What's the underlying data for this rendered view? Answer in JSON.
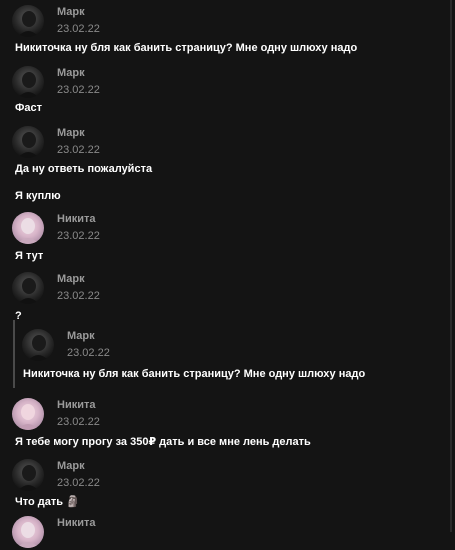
{
  "messages": [
    {
      "author": "Марк",
      "date": "23.02.22",
      "text": "Никиточка ну бля как банить страницу? Мне одну шлюху надо"
    },
    {
      "author": "Марк",
      "date": "23.02.22",
      "text": "Фаст"
    },
    {
      "author": "Марк",
      "date": "23.02.22",
      "text": "Да ну ответь пожалуйста",
      "text2": "Я куплю"
    },
    {
      "author": "Никита",
      "date": "23.02.22",
      "text": "Я тут"
    },
    {
      "author": "Марк",
      "date": "23.02.22",
      "text": "?"
    },
    {
      "author": "Никита",
      "date": "23.02.22",
      "text": "Я тебе могу прогу за 350₽ дать и все мне лень делать"
    },
    {
      "author": "Марк",
      "date": "23.02.22",
      "text": "Что дать 🗿"
    },
    {
      "author": "Никита"
    }
  ],
  "quote": {
    "author": "Марк",
    "date": "23.02.22",
    "text": "Никиточка ну бля как банить страницу? Мне одну шлюху надо"
  },
  "colors": {
    "background": "#141414",
    "author": "#9a9a9a",
    "date": "#8a8a8a",
    "text": "#ffffff",
    "quote_bar": "#4a4a4a"
  },
  "avatars": {
    "mark": "dark-portrait-avatar",
    "nikita": "pink-portrait-avatar"
  }
}
